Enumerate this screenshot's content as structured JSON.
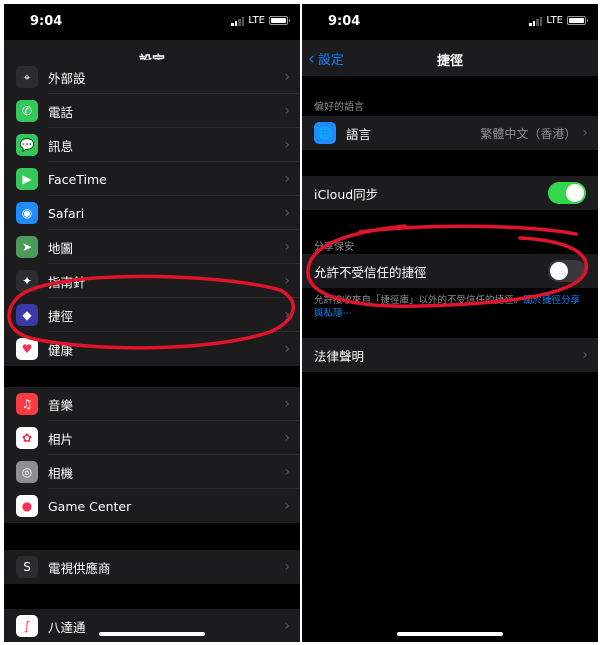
{
  "left": {
    "status": {
      "time": "9:04",
      "network": "LTE"
    },
    "nav": {
      "title": "設定"
    },
    "group1": [
      {
        "label": "外部設",
        "icon": "compass-icon",
        "color": "#2c2c2e",
        "glyph": "⌖"
      },
      {
        "label": "電話",
        "icon": "phone-icon",
        "color": "#34c759",
        "glyph": "✆"
      },
      {
        "label": "訊息",
        "icon": "message-icon",
        "color": "#34c759",
        "glyph": "💬"
      },
      {
        "label": "FaceTime",
        "icon": "facetime-icon",
        "color": "#34c759",
        "glyph": "▶"
      },
      {
        "label": "Safari",
        "icon": "safari-icon",
        "color": "#1f8bff",
        "glyph": "◉"
      },
      {
        "label": "地圖",
        "icon": "maps-icon",
        "color": "#4a9a5a",
        "glyph": "➤"
      },
      {
        "label": "指南針",
        "icon": "compass-icon",
        "color": "#2c2c2e",
        "glyph": "✦"
      },
      {
        "label": "捷徑",
        "icon": "shortcuts-icon",
        "color": "#3a3aa8",
        "glyph": "◆"
      },
      {
        "label": "健康",
        "icon": "health-icon",
        "color": "#ffffff",
        "glyph": "♥"
      }
    ],
    "group2": [
      {
        "label": "音樂",
        "icon": "music-icon",
        "color": "#fc3c44",
        "glyph": "♫"
      },
      {
        "label": "相片",
        "icon": "photos-icon",
        "color": "#ffffff",
        "glyph": "✿"
      },
      {
        "label": "相機",
        "icon": "camera-icon",
        "color": "#8e8e93",
        "glyph": "◎"
      },
      {
        "label": "Game Center",
        "icon": "gamecenter-icon",
        "color": "#ffffff",
        "glyph": "●"
      }
    ],
    "group3": [
      {
        "label": "電視供應商",
        "icon": "tv-provider-icon",
        "color": "#2c2c2e",
        "glyph": "S"
      }
    ],
    "group4": [
      {
        "label": "八達通",
        "icon": "octopus-icon",
        "color": "#ffffff",
        "glyph": "∫"
      }
    ]
  },
  "right": {
    "status": {
      "time": "9:04",
      "network": "LTE"
    },
    "nav": {
      "back": "設定",
      "title": "捷徑"
    },
    "language_header": "偏好的語言",
    "language_label": "語言",
    "language_value": "繁體中文（香港）",
    "icloud_label": "iCloud同步",
    "sharing_header": "分享保安",
    "untrusted_label": "允許不受信任的捷徑",
    "untrusted_footer": "允許接收來自「捷徑庫」以外的不受信任的捷徑。",
    "untrusted_link": "關於捷徑分享與私隱⋯",
    "legal_label": "法律聲明",
    "icloud_on": true,
    "untrusted_on": false
  },
  "colors": {
    "accent": "#0a84ff",
    "toggle_on": "#32d74b",
    "annotation": "#e0142b"
  }
}
